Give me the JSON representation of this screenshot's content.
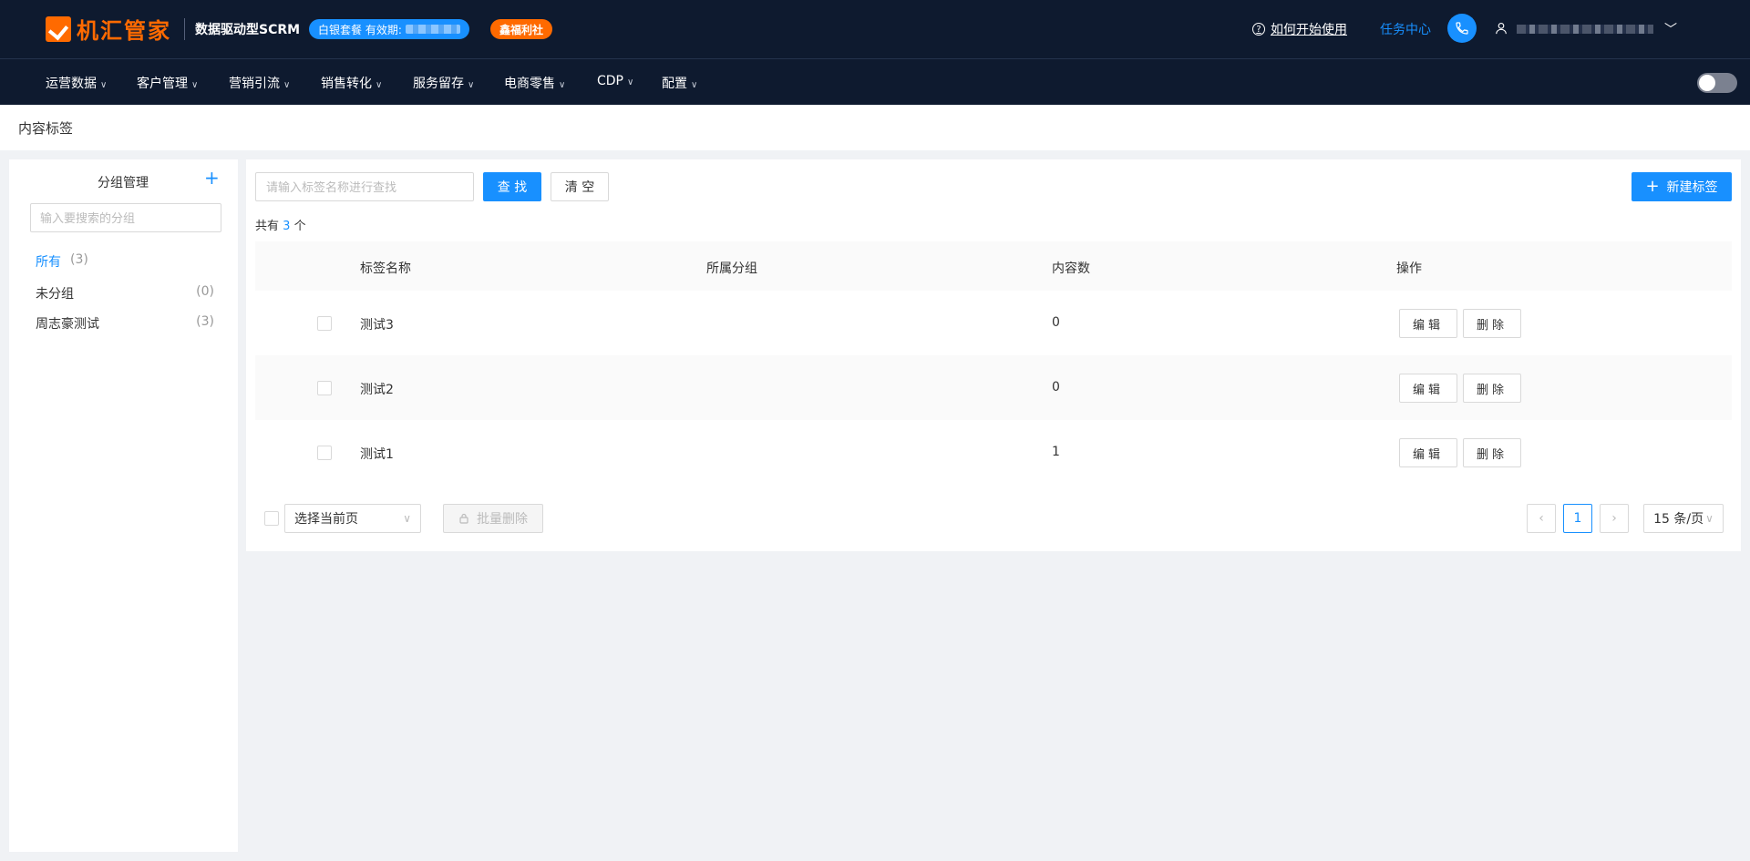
{
  "header": {
    "brand": "机汇管家",
    "subtitle": "数据驱动型SCRM",
    "plan_badge": "白银套餐 有效期:",
    "welfare_badge": "鑫福利社",
    "help_link": "如何开始使用",
    "task_center": "任务中心"
  },
  "nav": {
    "items": [
      {
        "label": "运营数据"
      },
      {
        "label": "客户管理"
      },
      {
        "label": "营销引流"
      },
      {
        "label": "销售转化"
      },
      {
        "label": "服务留存"
      },
      {
        "label": "电商零售"
      },
      {
        "label": "CDP"
      },
      {
        "label": "配置"
      }
    ]
  },
  "page": {
    "title": "内容标签"
  },
  "groups": {
    "title": "分组管理",
    "search_placeholder": "输入要搜索的分组",
    "items": [
      {
        "name": "所有",
        "count": "(3)"
      },
      {
        "name": "未分组",
        "count": "(0)"
      },
      {
        "name": "周志豪测试",
        "count": "(3)"
      }
    ]
  },
  "toolbar": {
    "search_placeholder": "请输入标签名称进行查找",
    "search_button": "查 找",
    "clear_button": "清 空",
    "new_button": "新建标签"
  },
  "total": {
    "prefix": "共有",
    "count": "3",
    "suffix": "个"
  },
  "table": {
    "columns": [
      "标签名称",
      "所属分组",
      "内容数",
      "操作"
    ],
    "rows": [
      {
        "name": "测试3",
        "group": "",
        "count": "0"
      },
      {
        "name": "测试2",
        "group": "",
        "count": "0"
      },
      {
        "name": "测试1",
        "group": "",
        "count": "1"
      }
    ],
    "edit_label": "编辑",
    "delete_label": "删除"
  },
  "footer": {
    "select_label": "选择当前页",
    "batch_delete": "批量删除",
    "current_page": "1",
    "page_size": "15 条/页"
  },
  "colors": {
    "primary": "#1890ff",
    "brand_orange": "#ff6a00",
    "header_bg": "#0e1a2f"
  }
}
